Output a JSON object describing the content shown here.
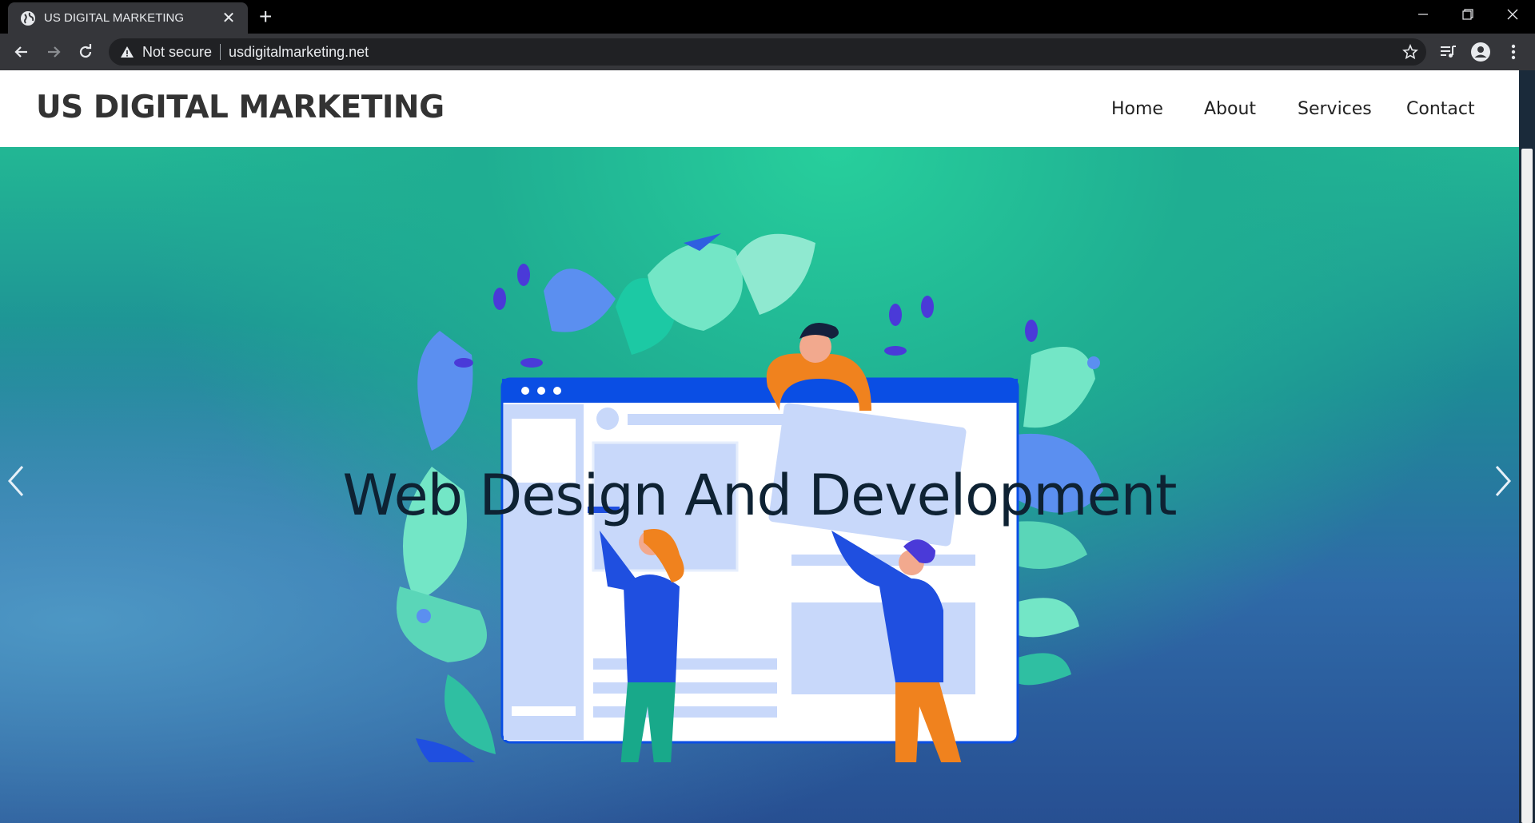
{
  "browser": {
    "tab_title": "US DIGITAL MARKETING",
    "security_label": "Not secure",
    "url": "usdigitalmarketing.net"
  },
  "site": {
    "brand": "US DIGITAL MARKETING",
    "nav": [
      "Home",
      "About",
      "Services",
      "Contact"
    ]
  },
  "hero": {
    "title": "Web Design And Development"
  },
  "colors": {
    "brand_text": "#333333",
    "hero_top": "#22b794",
    "hero_bottom": "#274f92",
    "browser_blue": "#0a4ee4"
  }
}
